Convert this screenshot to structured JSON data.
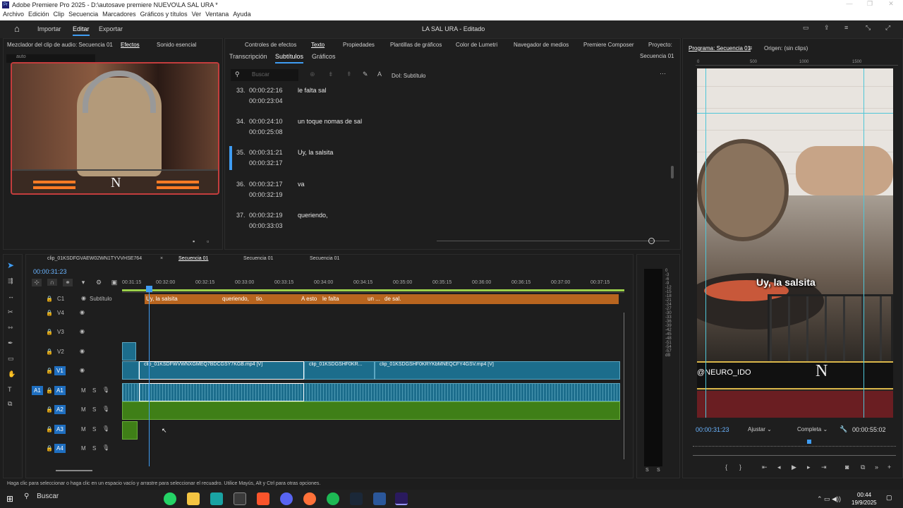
{
  "window": {
    "title": "Adobe Premiere Pro 2025 - D:\\autosave premiere NUEVO\\LA SAL URA *"
  },
  "menu": [
    "Archivo",
    "Edición",
    "Clip",
    "Secuencia",
    "Marcadores",
    "Gráficos y títulos",
    "Ver",
    "Ventana",
    "Ayuda"
  ],
  "appbar": {
    "home": "⌂",
    "tabs": [
      "Importar",
      "Editar",
      "Exportar"
    ],
    "project": "LA SAL URA - Editado"
  },
  "left_panel": {
    "tabs": [
      "Mezclador del clip de audio: Secuencia 01",
      "Efectos",
      "Sonido esencial"
    ],
    "search": "auto"
  },
  "center_panel": {
    "tabs": [
      "Controles de efectos",
      "Texto",
      "Propiedades",
      "Plantillas de gráficos",
      "Color de Lumetri",
      "Navegador de medios",
      "Premiere Composer",
      "Proyecto:"
    ],
    "subtabs": [
      "Transcripción",
      "Subtítulos",
      "Gráficos"
    ],
    "sequence": "Secuencia 01",
    "search_placeholder": "Buscar",
    "track": "DoI: Subtítulo",
    "captions": [
      {
        "num": "33.",
        "start": "00:00:22:16",
        "end": "00:00:23:04",
        "text": "le falta sal"
      },
      {
        "num": "34.",
        "start": "00:00:24:10",
        "end": "00:00:25:08",
        "text": "un toque nomas de sal"
      },
      {
        "num": "35.",
        "start": "00:00:31:21",
        "end": "00:00:32:17",
        "text": "Uy, la salsita"
      },
      {
        "num": "36.",
        "start": "00:00:32:17",
        "end": "00:00:32:19",
        "text": "va"
      },
      {
        "num": "37.",
        "start": "00:00:32:19",
        "end": "00:00:33:03",
        "text": "queriendo,"
      }
    ]
  },
  "program": {
    "title": "Programa: Secuencia 01",
    "source": "Origen: (sin clips)",
    "ruler": [
      "0",
      "500",
      "1000",
      "1500"
    ],
    "caption": "Uy, la salsita",
    "overlay_name": "@NEURO_IDO",
    "logo": "N",
    "timecode": "00:00:31:23",
    "fit": "Ajustar",
    "quality": "Completa",
    "duration": "00:00:55:02"
  },
  "timeline": {
    "tabs": [
      "clip_01KSDFGVAEW02WN1TYVVHSE764",
      "Secuencia 01",
      "Secuencia 01",
      "Secuencia 01"
    ],
    "timecode": "00:00:31:23",
    "ruler": [
      "00:31:15",
      "00:32:00",
      "00:32:15",
      "00:33:00",
      "00:33:15",
      "00:34:00",
      "00:34:15",
      "00:35:00",
      "00:35:15",
      "00:36:00",
      "00:36:15",
      "00:37:00",
      "00:37:15"
    ],
    "tracks": [
      "C1",
      "V4",
      "V3",
      "V2",
      "V1",
      "A1",
      "A2",
      "A3",
      "A4"
    ],
    "subtitle_label": "Subtítulo",
    "caption_segments": [
      "Uy, la salsita",
      "queriendo,",
      "tio.",
      "A esto",
      "le falta",
      "un ...",
      "de sal."
    ],
    "clips": [
      "clip_01KSDFWVWNXGMEQ7BDCGSY7KGB.mp4 [V]",
      "clip_01KSDGSHF0KR...",
      "clip_01KSDGSHF0KRYKbMNEQCFY4GSV.mp4 [V]"
    ],
    "meter": [
      "0",
      "-3",
      "-6",
      "-9",
      "-12",
      "-15",
      "-18",
      "-21",
      "-24",
      "-27",
      "-30",
      "-33",
      "-36",
      "-39",
      "-42",
      "-45",
      "-48",
      "-51",
      "-54",
      "-57",
      "dB"
    ]
  },
  "status": "Haga clic para seleccionar o haga clic en un espacio vacío y arrastre para seleccionar el recuadro. Utilice Mayús, Alt y Ctrl para otras opciones.",
  "taskbar": {
    "search": "Buscar",
    "time": "00:44",
    "date": "19/9/2025"
  },
  "colors": {
    "accent": "#3f9cf2",
    "caption_track": "#b8651f",
    "video_clip": "#1c6d8c",
    "audio_clip": "#3f7f17"
  }
}
